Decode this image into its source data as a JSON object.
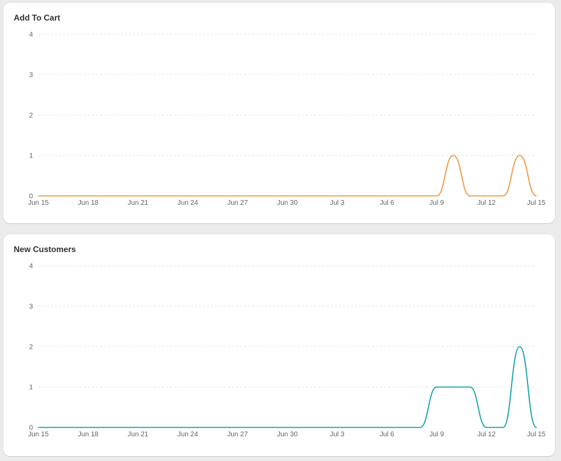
{
  "chart_data": [
    {
      "type": "line",
      "title": "Add To Cart",
      "color": "#f09540",
      "x": [
        "Jun 15",
        "Jun 16",
        "Jun 17",
        "Jun 18",
        "Jun 19",
        "Jun 20",
        "Jun 21",
        "Jun 22",
        "Jun 23",
        "Jun 24",
        "Jun 25",
        "Jun 26",
        "Jun 27",
        "Jun 28",
        "Jun 29",
        "Jun 30",
        "Jul 1",
        "Jul 2",
        "Jul 3",
        "Jul 4",
        "Jul 5",
        "Jul 6",
        "Jul 7",
        "Jul 8",
        "Jul 9",
        "Jul 10",
        "Jul 11",
        "Jul 12",
        "Jul 13",
        "Jul 14",
        "Jul 15"
      ],
      "values": [
        0,
        0,
        0,
        0,
        0,
        0,
        0,
        0,
        0,
        0,
        0,
        0,
        0,
        0,
        0,
        0,
        0,
        0,
        0,
        0,
        0,
        0,
        0,
        0,
        0,
        1,
        0,
        0,
        0,
        1,
        0
      ],
      "x_tick_labels": [
        "Jun 15",
        "Jun 18",
        "Jun 21",
        "Jun 24",
        "Jun 27",
        "Jun 30",
        "Jul 3",
        "Jul 6",
        "Jul 9",
        "Jul 12",
        "Jul 15"
      ],
      "ylim": [
        0,
        4
      ],
      "y_ticks": [
        0,
        1,
        2,
        3,
        4
      ],
      "grid": true,
      "gridline_color": "#e3e3e3"
    },
    {
      "type": "line",
      "title": "New Customers",
      "color": "#15a0a8",
      "x": [
        "Jun 15",
        "Jun 16",
        "Jun 17",
        "Jun 18",
        "Jun 19",
        "Jun 20",
        "Jun 21",
        "Jun 22",
        "Jun 23",
        "Jun 24",
        "Jun 25",
        "Jun 26",
        "Jun 27",
        "Jun 28",
        "Jun 29",
        "Jun 30",
        "Jul 1",
        "Jul 2",
        "Jul 3",
        "Jul 4",
        "Jul 5",
        "Jul 6",
        "Jul 7",
        "Jul 8",
        "Jul 9",
        "Jul 10",
        "Jul 11",
        "Jul 12",
        "Jul 13",
        "Jul 14",
        "Jul 15"
      ],
      "values": [
        0,
        0,
        0,
        0,
        0,
        0,
        0,
        0,
        0,
        0,
        0,
        0,
        0,
        0,
        0,
        0,
        0,
        0,
        0,
        0,
        0,
        0,
        0,
        0,
        1,
        1,
        1,
        0,
        0,
        2,
        0
      ],
      "x_tick_labels": [
        "Jun 15",
        "Jun 18",
        "Jun 21",
        "Jun 24",
        "Jun 27",
        "Jun 30",
        "Jul 3",
        "Jul 6",
        "Jul 9",
        "Jul 12",
        "Jul 15"
      ],
      "ylim": [
        0,
        4
      ],
      "y_ticks": [
        0,
        1,
        2,
        3,
        4
      ],
      "grid": true,
      "gridline_color": "#e3e3e3"
    }
  ]
}
